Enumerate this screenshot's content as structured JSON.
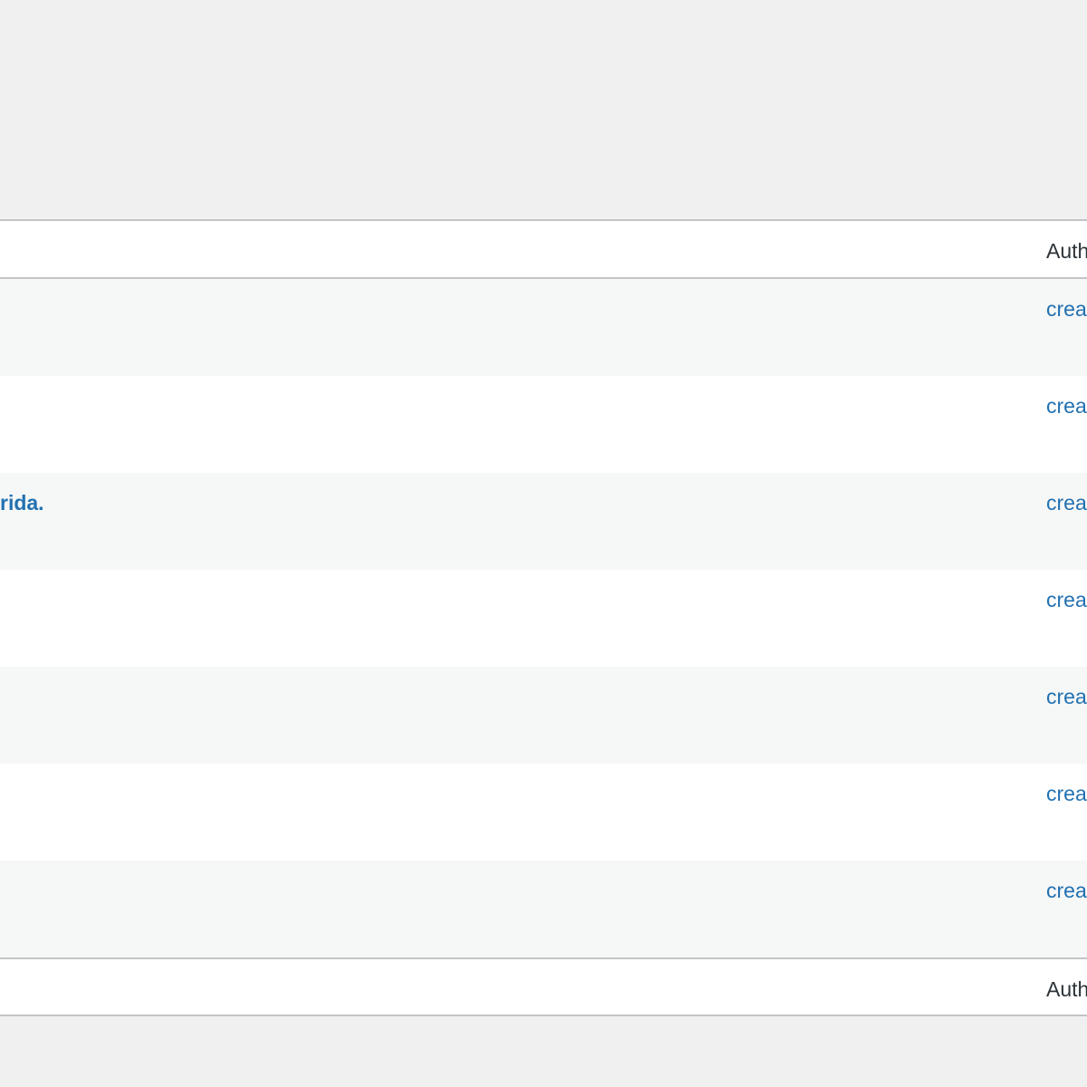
{
  "table": {
    "header": {
      "author": "Author"
    },
    "footer": {
      "author": "Author"
    },
    "rows": [
      {
        "title": "",
        "author": "creator"
      },
      {
        "title": "",
        "author": "creator"
      },
      {
        "title": "rida.",
        "author": "creator"
      },
      {
        "title": "",
        "author": "creator"
      },
      {
        "title": "",
        "author": "creator"
      },
      {
        "title": "",
        "author": "creator"
      },
      {
        "title": "",
        "author": "creator"
      }
    ]
  }
}
